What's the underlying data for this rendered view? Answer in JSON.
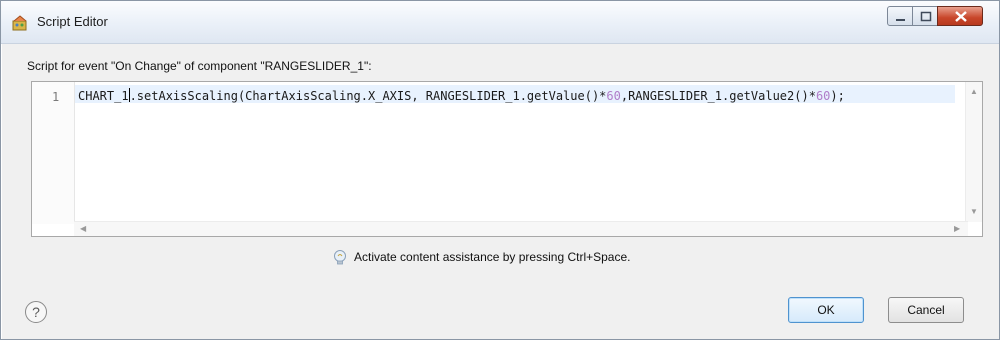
{
  "window": {
    "title": "Script Editor",
    "controls": {
      "minimize": "minimize",
      "maximize": "maximize",
      "close": "close"
    }
  },
  "editor": {
    "caption": "Script for event \"On Change\" of component \"RANGESLIDER_1\":",
    "line_number": "1",
    "code_before_caret": "CHART_1",
    "code_part1": ".setAxisScaling(ChartAxisScaling.X_AXIS, RANGESLIDER_1.getValue()*",
    "num1": "60",
    "code_part2": ",RANGESLIDER_1.getValue2()*",
    "num2": "60",
    "code_end": ");"
  },
  "hint": {
    "text": "Activate content assistance by pressing Ctrl+Space.",
    "icon": "lightbulb-icon"
  },
  "footer": {
    "help": "?",
    "ok_label": "OK",
    "cancel_label": "Cancel"
  },
  "colors": {
    "number": "#b07dc9",
    "current_line": "#e8f2fe",
    "close_button": "#c8462a",
    "default_button_border": "#4f93cf"
  }
}
